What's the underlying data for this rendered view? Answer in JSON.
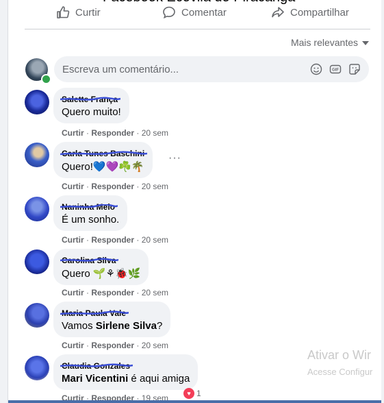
{
  "page_title": "Facebook Ecovila do Piracanga",
  "actions": {
    "like": "Curtir",
    "comment": "Comentar",
    "share": "Compartilhar"
  },
  "sort_label": "Mais relevantes",
  "composer": {
    "placeholder": "Escreva um comentário..."
  },
  "comments": [
    {
      "name": "Salette França",
      "text": "Quero muito!",
      "like": "Curtir",
      "reply": "Responder",
      "time": "20 sem"
    },
    {
      "name": "Carla Tunes Baschini",
      "text": "Quero!💙💜☘️🌴",
      "like": "Curtir",
      "reply": "Responder",
      "time": "20 sem"
    },
    {
      "name": "Naninha Melo",
      "text": "É um sonho.",
      "like": "Curtir",
      "reply": "Responder",
      "time": "20 sem"
    },
    {
      "name": "Carolina Silva",
      "text": "Quero 🌱⚘🐞🌿",
      "like": "Curtir",
      "reply": "Responder",
      "time": "20 sem"
    },
    {
      "name": "Maria Paula Vale",
      "text_prefix": "Vamos ",
      "mention": "Sirlene Silva",
      "text_suffix": "?",
      "like": "Curtir",
      "reply": "Responder",
      "time": "20 sem"
    },
    {
      "name": "Claudia Gonzales",
      "mention": "Mari Vicentini",
      "text_suffix": " é aqui amiga",
      "like": "Curtir",
      "reply": "Responder",
      "time": "19 sem",
      "reactions": "1"
    }
  ],
  "watermark": {
    "line1": "Ativar o Wir",
    "line2": "Acesse Configur"
  },
  "colors": {
    "bubble": "#f0f2f5",
    "secondary_text": "#65676b",
    "scribble": "#3b4fd6",
    "online": "#31a24c",
    "love": "#f33e58"
  }
}
